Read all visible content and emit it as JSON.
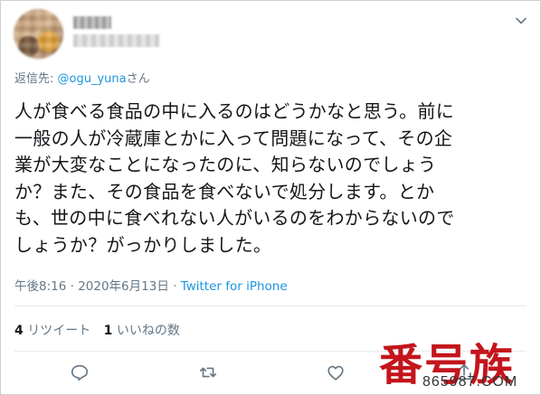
{
  "header": {
    "display_name": "",
    "handle": ""
  },
  "reply_to": {
    "prefix": "返信先: ",
    "user": "@ogu_yuna",
    "suffix": "さん"
  },
  "tweet": {
    "text": "人が食べる食品の中に入るのはどうかなと思う。前に\n一般の人が冷蔵庫とかに入って問題になって、その企\n業が大変なことになったのに、知らないのでしょう\nか？また、その食品を食べないで処分します。とか\nも、世の中に食べれない人がいるのをわからないので\nしょうか？がっかりしました。"
  },
  "meta": {
    "timestamp": "午後8:16 · 2020年6月13日 · ",
    "source": "Twitter for iPhone"
  },
  "stats": {
    "retweets_count": "4",
    "retweets_label": " リツイート",
    "likes_count": "1",
    "likes_label": " いいねの数"
  },
  "icons": {
    "reply": "reply-icon",
    "retweet": "retweet-icon",
    "like": "heart-icon",
    "share": "share-icon",
    "menu": "chevron-down-icon"
  },
  "colors": {
    "link": "#1b95e0",
    "secondary_text": "#657786",
    "watermark": "#c4151c"
  },
  "watermark": {
    "logo_text": "番号族",
    "url": "865987.COM"
  }
}
